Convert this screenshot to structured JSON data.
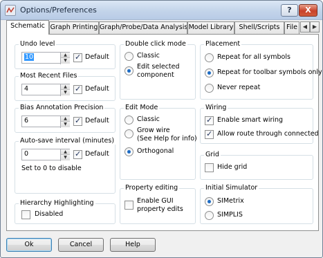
{
  "window": {
    "title": "Options/Preferences",
    "help_btn": "?",
    "close_btn": "X"
  },
  "tabs": [
    "Schematic",
    "Graph Printing",
    "Graph/Probe/Data Analysis",
    "Model Library",
    "Shell/Scripts",
    "File"
  ],
  "active_tab": "Schematic",
  "undo": {
    "title": "Undo level",
    "value": "10",
    "default_label": "Default",
    "default_checked": true
  },
  "recent": {
    "title": "Most Recent Files",
    "value": "4",
    "default_label": "Default",
    "default_checked": true
  },
  "bias": {
    "title": "Bias Annotation Precision",
    "value": "6",
    "default_label": "Default",
    "default_checked": true
  },
  "autosave": {
    "title": "Auto-save interval (minutes)",
    "value": "0",
    "default_label": "Default",
    "default_checked": true,
    "hint": "Set to 0 to disable"
  },
  "hierarchy": {
    "title": "Hierarchy Highlighting",
    "disabled_label": "Disabled",
    "disabled_checked": false
  },
  "dblclick": {
    "title": "Double click mode",
    "opt1": "Classic",
    "opt2_line1": "Edit selected",
    "opt2_line2": "component",
    "selected": "Edit selected component"
  },
  "editmode": {
    "title": "Edit Mode",
    "opt1": "Classic",
    "opt2_line1": "Grow wire",
    "opt2_line2": "(See Help for info)",
    "opt3": "Orthogonal",
    "selected": "Orthogonal"
  },
  "propedit": {
    "title": "Property editing",
    "label_line1": "Enable GUI",
    "label_line2": "property edits",
    "checked": false
  },
  "placement": {
    "title": "Placement",
    "opt1": "Repeat for all symbols",
    "opt2": "Repeat for toolbar symbols only",
    "opt3": "Never repeat",
    "selected": "Repeat for toolbar symbols only"
  },
  "wiring": {
    "title": "Wiring",
    "opt1": "Enable smart wiring",
    "opt2": "Allow route through connected",
    "opt1_checked": true,
    "opt2_checked": true
  },
  "grid": {
    "title": "Grid",
    "hide_label": "Hide grid",
    "hide_checked": false
  },
  "simulator": {
    "title": "Initial Simulator",
    "opt1": "SIMetrix",
    "opt2": "SIMPLIS",
    "selected": "SIMetrix"
  },
  "buttons": {
    "ok": "Ok",
    "cancel": "Cancel",
    "help": "Help"
  }
}
